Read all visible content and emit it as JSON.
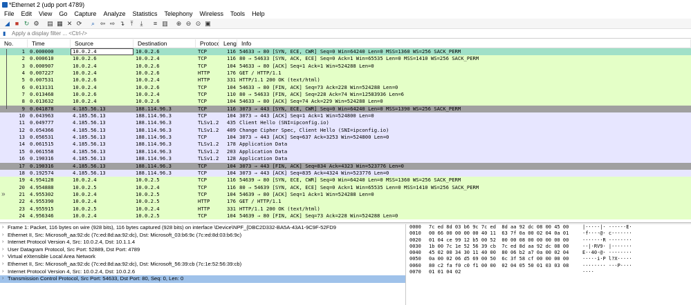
{
  "window": {
    "title": "*Ethernet 2 (udp port 4789)"
  },
  "menu": [
    "File",
    "Edit",
    "View",
    "Go",
    "Capture",
    "Analyze",
    "Statistics",
    "Telephony",
    "Wireless",
    "Tools",
    "Help"
  ],
  "toolbar_icons": [
    "shark-fin-icon",
    "stop-icon",
    "restart-icon",
    "options-icon",
    "open-icon",
    "save-icon",
    "close-file-icon",
    "reload-icon",
    "find-icon",
    "back-icon",
    "forward-icon",
    "goto-icon",
    "first-icon",
    "last-icon",
    "autoscroll-icon",
    "colorize-icon",
    "zoom-in-icon",
    "zoom-out-icon",
    "zoom-reset-icon",
    "resize-columns-icon"
  ],
  "filter": {
    "placeholder": "Apply a display filter ... <Ctrl-/>"
  },
  "columns": [
    "No.",
    "Time",
    "Source",
    "Destination",
    "Protocol",
    "Length",
    "Info"
  ],
  "packets": [
    {
      "no": "1",
      "time": "0.000000",
      "src": "10.0.2.4",
      "dst": "10.0.2.6",
      "proto": "TCP",
      "len": "116",
      "info": "54633 → 80 [SYN, ECE, CWR] Seq=0 Win=64240 Len=0 MSS=1360 WS=256 SACK_PERM",
      "cls": "row-sel"
    },
    {
      "no": "2",
      "time": "0.000610",
      "src": "10.0.2.6",
      "dst": "10.0.2.4",
      "proto": "TCP",
      "len": "116",
      "info": "80 → 54633 [SYN, ACK, ECE] Seq=0 Ack=1 Win=65535 Len=0 MSS=1410 WS=256 SACK_PERM",
      "cls": "row-tcp"
    },
    {
      "no": "3",
      "time": "0.000907",
      "src": "10.0.2.4",
      "dst": "10.0.2.6",
      "proto": "TCP",
      "len": "104",
      "info": "54633 → 80 [ACK] Seq=1 Ack=1 Win=524288 Len=0",
      "cls": "row-tcp"
    },
    {
      "no": "4",
      "time": "0.007227",
      "src": "10.0.2.4",
      "dst": "10.0.2.6",
      "proto": "HTTP",
      "len": "176",
      "info": "GET / HTTP/1.1",
      "cls": "row-http"
    },
    {
      "no": "5",
      "time": "0.007531",
      "src": "10.0.2.6",
      "dst": "10.0.2.4",
      "proto": "HTTP",
      "len": "331",
      "info": "HTTP/1.1 200 OK  (text/html)",
      "cls": "row-http"
    },
    {
      "no": "6",
      "time": "0.013131",
      "src": "10.0.2.4",
      "dst": "10.0.2.6",
      "proto": "TCP",
      "len": "104",
      "info": "54633 → 80 [FIN, ACK] Seq=73 Ack=228 Win=524288 Len=0",
      "cls": "row-tcp"
    },
    {
      "no": "7",
      "time": "0.013468",
      "src": "10.0.2.6",
      "dst": "10.0.2.4",
      "proto": "TCP",
      "len": "110",
      "info": "80 → 54633 [FIN, ACK] Seq=228 Ack=74 Win=12583936 Len=6",
      "cls": "row-tcp"
    },
    {
      "no": "8",
      "time": "0.013632",
      "src": "10.0.2.4",
      "dst": "10.0.2.6",
      "proto": "TCP",
      "len": "104",
      "info": "54633 → 80 [ACK] Seq=74 Ack=229 Win=524288 Len=0",
      "cls": "row-tcp"
    },
    {
      "no": "9",
      "time": "0.041878",
      "src": "4.185.56.13",
      "dst": "188.114.96.3",
      "proto": "TCP",
      "len": "116",
      "info": "3073 → 443 [SYN, ECE, CWR] Seq=0 Win=64240 Len=0 MSS=1390 WS=256 SACK_PERM",
      "cls": "row-dark"
    },
    {
      "no": "10",
      "time": "0.043963",
      "src": "4.185.56.13",
      "dst": "188.114.96.3",
      "proto": "TCP",
      "len": "104",
      "info": "3073 → 443 [ACK] Seq=1 Ack=1 Win=524800 Len=0",
      "cls": "row-tls"
    },
    {
      "no": "11",
      "time": "0.049777",
      "src": "4.185.56.13",
      "dst": "188.114.96.3",
      "proto": "TLSv1.2",
      "len": "435",
      "info": "Client Hello (SNI=ipconfig.io)",
      "cls": "row-tls"
    },
    {
      "no": "12",
      "time": "0.054366",
      "src": "4.185.56.13",
      "dst": "188.114.96.3",
      "proto": "TLSv1.2",
      "len": "409",
      "info": "Change Cipher Spec, Client Hello (SNI=ipconfig.io)",
      "cls": "row-tls"
    },
    {
      "no": "13",
      "time": "0.056531",
      "src": "4.185.56.13",
      "dst": "188.114.96.3",
      "proto": "TCP",
      "len": "104",
      "info": "3073 → 443 [ACK] Seq=637 Ack=3253 Win=524800 Len=0",
      "cls": "row-tls"
    },
    {
      "no": "14",
      "time": "0.061515",
      "src": "4.185.56.13",
      "dst": "188.114.96.3",
      "proto": "TLSv1.2",
      "len": "178",
      "info": "Application Data",
      "cls": "row-tls"
    },
    {
      "no": "15",
      "time": "0.061558",
      "src": "4.185.56.13",
      "dst": "188.114.96.3",
      "proto": "TLSv1.2",
      "len": "203",
      "info": "Application Data",
      "cls": "row-tls"
    },
    {
      "no": "16",
      "time": "0.190316",
      "src": "4.185.56.13",
      "dst": "188.114.96.3",
      "proto": "TLSv1.2",
      "len": "128",
      "info": "Application Data",
      "cls": "row-tls"
    },
    {
      "no": "17",
      "time": "0.190316",
      "src": "4.185.56.13",
      "dst": "188.114.96.3",
      "proto": "TCP",
      "len": "104",
      "info": "3073 → 443 [FIN, ACK] Seq=834 Ack=4323 Win=523776 Len=0",
      "cls": "row-dark"
    },
    {
      "no": "18",
      "time": "0.192574",
      "src": "4.185.56.13",
      "dst": "188.114.96.3",
      "proto": "TCP",
      "len": "104",
      "info": "3073 → 443 [ACK] Seq=835 Ack=4324 Win=523776 Len=0",
      "cls": "row-tls"
    },
    {
      "no": "19",
      "time": "4.954128",
      "src": "10.0.2.4",
      "dst": "10.0.2.5",
      "proto": "TCP",
      "len": "116",
      "info": "54639 → 80 [SYN, ECE, CWR] Seq=0 Win=64240 Len=0 MSS=1360 WS=256 SACK_PERM",
      "cls": "row-tcp"
    },
    {
      "no": "20",
      "time": "4.954888",
      "src": "10.0.2.5",
      "dst": "10.0.2.4",
      "proto": "TCP",
      "len": "116",
      "info": "80 → 54639 [SYN, ACK, ECE] Seq=0 Ack=1 Win=65535 Len=0 MSS=1410 WS=256 SACK_PERM",
      "cls": "row-tcp"
    },
    {
      "no": "21",
      "time": "4.955302",
      "src": "10.0.2.4",
      "dst": "10.0.2.5",
      "proto": "TCP",
      "len": "104",
      "info": "54639 → 80 [ACK] Seq=1 Ack=1 Win=524288 Len=0",
      "cls": "row-tcp"
    },
    {
      "no": "22",
      "time": "4.955390",
      "src": "10.0.2.4",
      "dst": "10.0.2.5",
      "proto": "HTTP",
      "len": "176",
      "info": "GET / HTTP/1.1",
      "cls": "row-http"
    },
    {
      "no": "23",
      "time": "4.955915",
      "src": "10.0.2.5",
      "dst": "10.0.2.4",
      "proto": "HTTP",
      "len": "331",
      "info": "HTTP/1.1 200 OK  (text/html)",
      "cls": "row-http"
    },
    {
      "no": "24",
      "time": "4.956346",
      "src": "10.0.2.4",
      "dst": "10.0.2.5",
      "proto": "TCP",
      "len": "104",
      "info": "54639 → 80 [FIN, ACK] Seq=73 Ack=228 Win=524288 Len=0",
      "cls": "row-tcp"
    }
  ],
  "details": [
    "Frame 1: Packet, 116 bytes on wire (928 bits), 116 bytes captured (928 bits) on interface \\Device\\NPF_{DBC2D332-BA5A-43A1-9C9F-52FD9",
    "Ethernet II, Src: Microsoft_aa:92:dc (7c:ed:8d:aa:92:dc), Dst: Microsoft_03:b6:9c (7c:ed:8d:03:b6:9c)",
    "Internet Protocol Version 4, Src: 10.0.2.4, Dst: 10.1.1.4",
    "User Datagram Protocol, Src Port: 52889, Dst Port: 4789",
    "Virtual eXtensible Local Area Network",
    "Ethernet II, Src: Microsoft_aa:92:dc (7c:ed:8d:aa:92:dc), Dst: Microsoft_56:39:cb (7c:1e:52:56:39:cb)",
    "Internet Protocol Version 4, Src: 10.0.2.4, Dst: 10.0.2.6",
    "Transmission Control Protocol, Src Port: 54633, Dst Port: 80, Seq: 0, Len: 0"
  ],
  "hex": [
    {
      "off": "0000",
      "bytes": "7c ed 8d 03 b6 9c 7c ed  8d aa 92 dc 08 00 45 00",
      "ascii": "|·····|· ······E·"
    },
    {
      "off": "0010",
      "bytes": "00 66 00 00 00 00 40 11  63 7f 0a 00 02 04 0a 01",
      "ascii": "·f····@· c·······"
    },
    {
      "off": "0020",
      "bytes": "01 04 ce 99 12 b5 00 52  00 00 08 00 00 00 00 00",
      "ascii": "·······R ········"
    },
    {
      "off": "0030",
      "bytes": "1b 00 7c 1e 52 56 39 cb  7c ed 8d aa 92 dc 08 00",
      "ascii": "··|·RV9· |·······"
    },
    {
      "off": "0040",
      "bytes": "45 02 00 34 30 11 40 00  80 06 b2 a7 0a 00 02 04",
      "ascii": "E··40·@· ········"
    },
    {
      "off": "0050",
      "bytes": "0a 00 02 06 d5 69 00 50  6c 3f 58 cf 00 00 00 00",
      "ascii": "·····i·P l?X·····"
    },
    {
      "off": "0060",
      "bytes": "80 c2 fa f0 c0 f1 00 00  02 04 05 50 01 03 03 08",
      "ascii": "········ ···P····"
    },
    {
      "off": "0070",
      "bytes": "01 01 04 02",
      "ascii": "····"
    }
  ]
}
